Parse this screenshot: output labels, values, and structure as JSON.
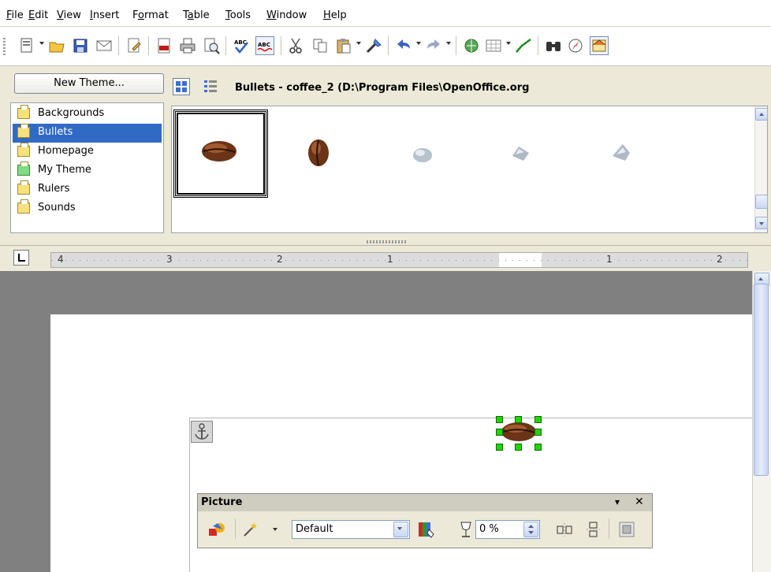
{
  "menu": {
    "items": [
      {
        "first": "F",
        "rest": "ile"
      },
      {
        "first": "E",
        "rest": "dit"
      },
      {
        "first": "V",
        "rest": "iew"
      },
      {
        "first": "I",
        "rest": "nsert"
      },
      {
        "pre": "F",
        "first": "o",
        "rest": "rmat"
      },
      {
        "pre": "T",
        "first": "a",
        "rest": "ble"
      },
      {
        "first": "T",
        "rest": "ools"
      },
      {
        "first": "W",
        "rest": "indow"
      },
      {
        "first": "H",
        "rest": "elp"
      }
    ]
  },
  "gallery": {
    "new_theme_label": "New Theme...",
    "title": "Bullets - coffee_2 (D:\\Program Files\\OpenOffice.org",
    "themes": [
      "Backgrounds",
      "Bullets",
      "Homepage",
      "My Theme",
      "Rulers",
      "Sounds"
    ],
    "selected_theme": "Bullets"
  },
  "ruler": {
    "labels": [
      "4",
      "3",
      "2",
      "1",
      "1",
      "2"
    ]
  },
  "picture_toolbar": {
    "title": "Picture",
    "menu_glyph": "▾",
    "close_glyph": "✕",
    "filter_value": "Default",
    "transparency_value": "0 %"
  },
  "colors": {
    "selection": "#316ac5",
    "handle": "#24d400",
    "doc_background": "#808080"
  }
}
